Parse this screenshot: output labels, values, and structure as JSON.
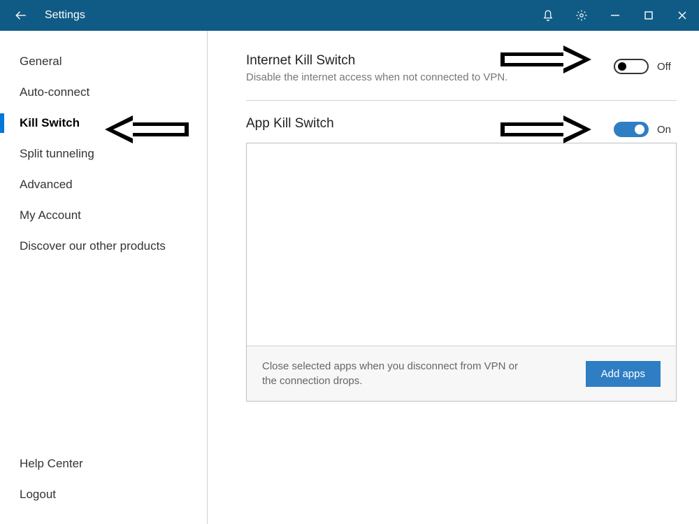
{
  "titlebar": {
    "title": "Settings"
  },
  "sidebar": {
    "items": [
      {
        "label": "General"
      },
      {
        "label": "Auto-connect"
      },
      {
        "label": "Kill Switch"
      },
      {
        "label": "Split tunneling"
      },
      {
        "label": "Advanced"
      },
      {
        "label": "My Account"
      },
      {
        "label": "Discover our other products"
      }
    ],
    "bottom": [
      {
        "label": "Help Center"
      },
      {
        "label": "Logout"
      }
    ]
  },
  "main": {
    "internet_kill": {
      "title": "Internet Kill Switch",
      "subtitle": "Disable the internet access when not connected to VPN.",
      "state_label": "Off"
    },
    "app_kill": {
      "title": "App Kill Switch",
      "state_label": "On",
      "footer_msg": "Close selected apps when you disconnect from VPN or the connection drops.",
      "add_button": "Add apps"
    }
  }
}
